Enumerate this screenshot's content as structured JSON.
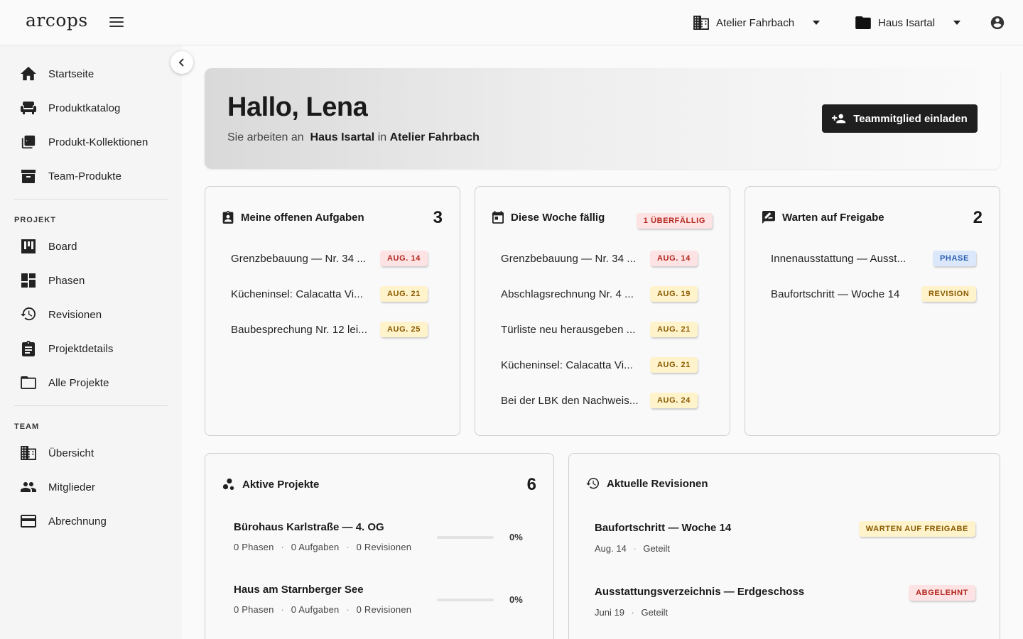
{
  "topbar": {
    "logo": "arcops",
    "org": "Atelier Fahrbach",
    "project": "Haus Isartal"
  },
  "sidebar": {
    "main_items": [
      {
        "label": "Startseite",
        "icon": "home-icon"
      },
      {
        "label": "Produktkatalog",
        "icon": "sofa-icon"
      },
      {
        "label": "Produkt-Kollektionen",
        "icon": "collections-icon"
      },
      {
        "label": "Team-Produkte",
        "icon": "archive-icon"
      }
    ],
    "project_label": "PROJEKT",
    "project_items": [
      {
        "label": "Board",
        "icon": "board-icon"
      },
      {
        "label": "Phasen",
        "icon": "dashboard-icon"
      },
      {
        "label": "Revisionen",
        "icon": "history-icon"
      },
      {
        "label": "Projektdetails",
        "icon": "clipboard-icon"
      },
      {
        "label": "Alle Projekte",
        "icon": "folder-icon"
      }
    ],
    "team_label": "TEAM",
    "team_items": [
      {
        "label": "Übersicht",
        "icon": "building-icon"
      },
      {
        "label": "Mitglieder",
        "icon": "people-icon"
      },
      {
        "label": "Abrechnung",
        "icon": "credit-card-icon"
      }
    ]
  },
  "hero": {
    "greeting": "Hallo, Lena",
    "sub_prefix": "Sie arbeiten an",
    "project": "Haus Isartal",
    "sub_mid": "in",
    "org": "Atelier Fahrbach",
    "invite_label": "Teammitglied einladen"
  },
  "tasks_card": {
    "title": "Meine offenen Aufgaben",
    "count": "3",
    "items": [
      {
        "title": "Grenzbebauung — Nr. 34 ...",
        "chip": "AUG. 14",
        "tone": "red"
      },
      {
        "title": "Kücheninsel: Calacatta Vi...",
        "chip": "AUG. 21",
        "tone": "yellow"
      },
      {
        "title": "Baubesprechung Nr. 12 lei...",
        "chip": "AUG. 25",
        "tone": "yellow"
      }
    ]
  },
  "week_card": {
    "title": "Diese Woche fällig",
    "overdue_chip": "1 ÜBERFÄLLIG",
    "items": [
      {
        "title": "Grenzbebauung — Nr. 34 ...",
        "chip": "AUG. 14",
        "tone": "red"
      },
      {
        "title": "Abschlagsrechnung Nr. 4 ...",
        "chip": "AUG. 19",
        "tone": "yellow"
      },
      {
        "title": "Türliste neu herausgeben ...",
        "chip": "AUG. 21",
        "tone": "yellow"
      },
      {
        "title": "Kücheninsel: Calacatta Vi...",
        "chip": "AUG. 21",
        "tone": "yellow"
      },
      {
        "title": "Bei der LBK den Nachweis...",
        "chip": "AUG. 24",
        "tone": "yellow"
      }
    ]
  },
  "approval_card": {
    "title": "Warten auf Freigabe",
    "count": "2",
    "items": [
      {
        "title": "Innenausstattung — Ausst...",
        "chip": "PHASE",
        "tone": "blue"
      },
      {
        "title": "Baufortschritt — Woche 14",
        "chip": "REVISION",
        "tone": "yellow"
      }
    ]
  },
  "projects_card": {
    "title": "Aktive Projekte",
    "count": "6",
    "items": [
      {
        "name": "Bürohaus Karlstraße — 4. OG",
        "phasen": "0 Phasen",
        "aufgaben": "0 Aufgaben",
        "revisionen": "0 Revisionen",
        "sep": "·",
        "progress": 0,
        "progress_label": "0%"
      },
      {
        "name": "Haus am Starnberger See",
        "phasen": "0 Phasen",
        "aufgaben": "0 Aufgaben",
        "revisionen": "0 Revisionen",
        "sep": "·",
        "progress": 0,
        "progress_label": "0%"
      }
    ]
  },
  "revisions_card": {
    "title": "Aktuelle Revisionen",
    "items": [
      {
        "title": "Baufortschritt — Woche 14",
        "date": "Aug. 14",
        "sep": "·",
        "status": "Geteilt",
        "chip": "WARTEN AUF FREIGABE",
        "tone": "yellow"
      },
      {
        "title": "Ausstattungsverzeichnis — Erdgeschoss",
        "date": "Juni 19",
        "sep": "·",
        "status": "Geteilt",
        "chip": "ABGELEHNT",
        "tone": "red"
      }
    ]
  }
}
